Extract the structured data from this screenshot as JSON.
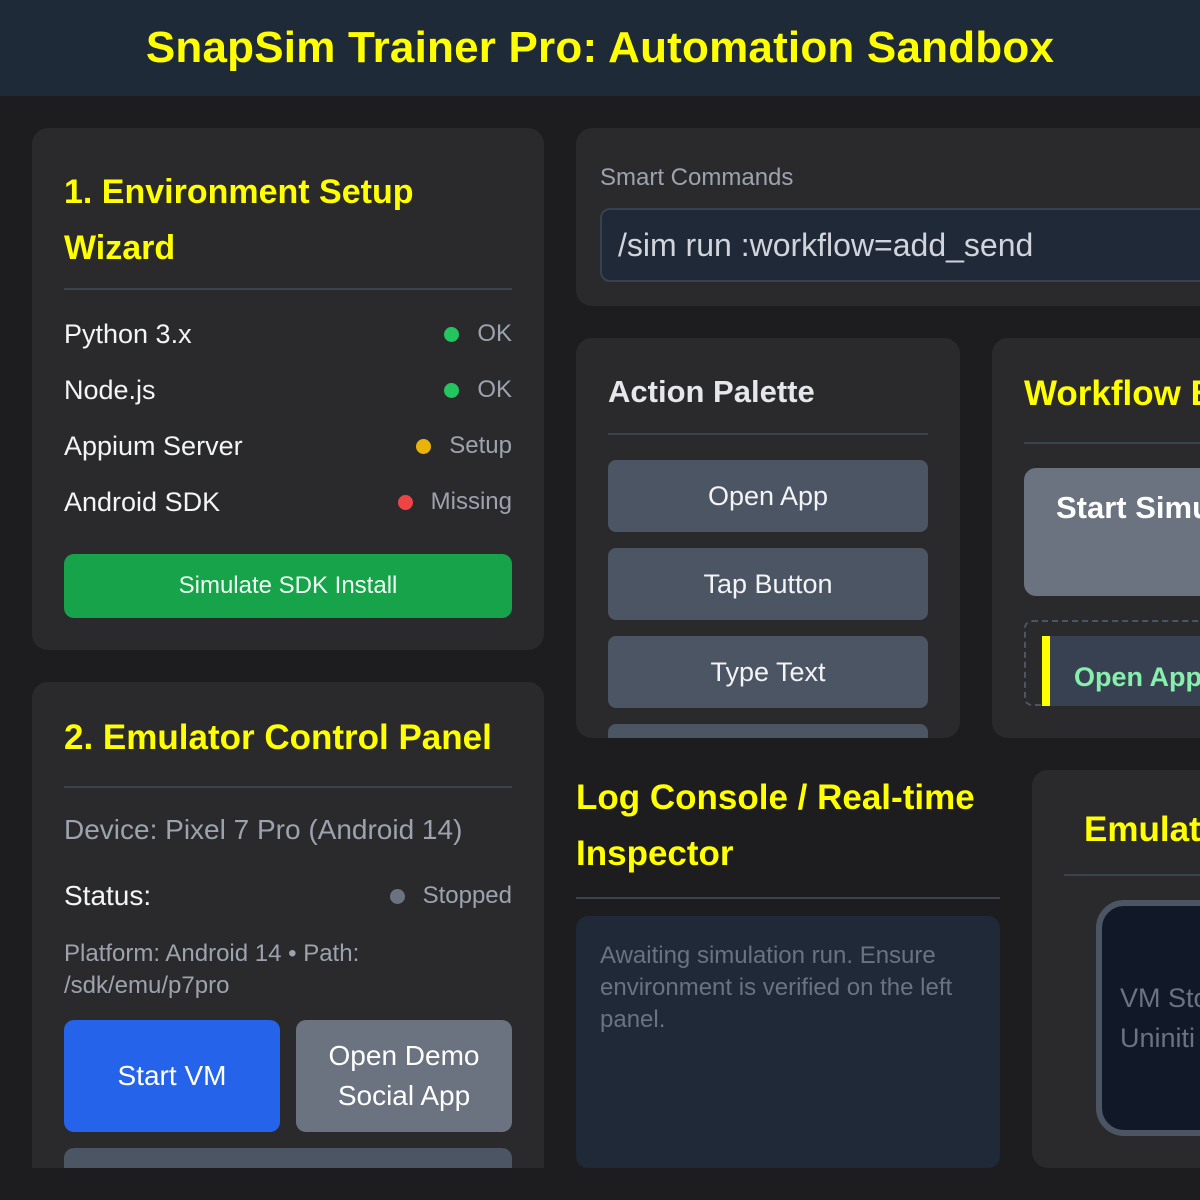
{
  "app_title": "SnapSim Trainer Pro: Automation Sandbox",
  "env_setup": {
    "title": "1. Environment Setup Wizard",
    "requirements": [
      {
        "name": "Python 3.x",
        "status": "OK",
        "color": "#22c55e"
      },
      {
        "name": "Node.js",
        "status": "OK",
        "color": "#22c55e"
      },
      {
        "name": "Appium Server",
        "status": "Setup",
        "color": "#eab308"
      },
      {
        "name": "Android SDK",
        "status": "Missing",
        "color": "#ef4444"
      }
    ],
    "install_button": "Simulate SDK Install"
  },
  "emulator_panel": {
    "title": "2. Emulator Control Panel",
    "device": "Device: Pixel 7 Pro (Android 14)",
    "status_label": "Status:",
    "status_value": "Stopped",
    "status_color": "#6b7280",
    "platform_info": "Platform: Android 14 • Path: /sdk/emu/p7pro",
    "start_button": "Start VM",
    "demo_button": "Open Demo Social App"
  },
  "smart_commands": {
    "label": "Smart Commands",
    "value": "/sim run :workflow=add_send"
  },
  "action_palette": {
    "title": "Action Palette",
    "items": [
      "Open App",
      "Tap Button",
      "Type Text"
    ]
  },
  "workflow_builder": {
    "title": "Workflow B",
    "start_button": "Start Simulation",
    "steps": [
      "Open App"
    ]
  },
  "log_console": {
    "title": "Log Console / Real-time Inspector",
    "message": "Awaiting simulation run. Ensure environment is verified on the left panel."
  },
  "emulator_screen": {
    "title": "Emulato",
    "screen_text_1": "VM Sto",
    "screen_text_2": "Uniniti"
  },
  "colors": {
    "accent_yellow": "#ffff00",
    "success_green": "#16a34a",
    "primary_blue": "#2563eb"
  }
}
